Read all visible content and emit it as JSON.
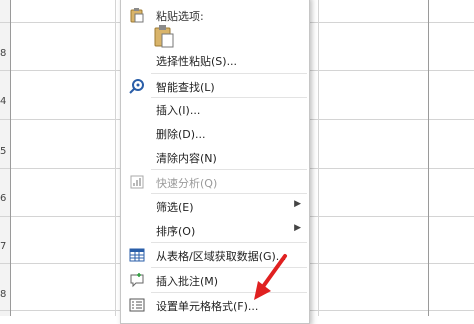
{
  "sheet": {
    "row_numbers": [
      "8",
      "4",
      "5",
      "6",
      "7",
      "8"
    ]
  },
  "menu": {
    "paste_options": {
      "label": "粘贴选项:"
    },
    "paste_special": {
      "label": "选择性粘贴(S)..."
    },
    "smart_lookup": {
      "label": "智能查找(L)"
    },
    "insert": {
      "label": "插入(I)..."
    },
    "delete": {
      "label": "删除(D)..."
    },
    "clear_contents": {
      "label": "清除内容(N)"
    },
    "quick_analysis": {
      "label": "快速分析(Q)"
    },
    "filter": {
      "label": "筛选(E)"
    },
    "sort": {
      "label": "排序(O)"
    },
    "get_data": {
      "label": "从表格/区域获取数据(G)..."
    },
    "insert_comment": {
      "label": "插入批注(M)"
    },
    "format_cells": {
      "label": "设置单元格格式(F)..."
    }
  },
  "colors": {
    "annotation_arrow": "#e02020",
    "menu_border": "#c6c6c6"
  }
}
